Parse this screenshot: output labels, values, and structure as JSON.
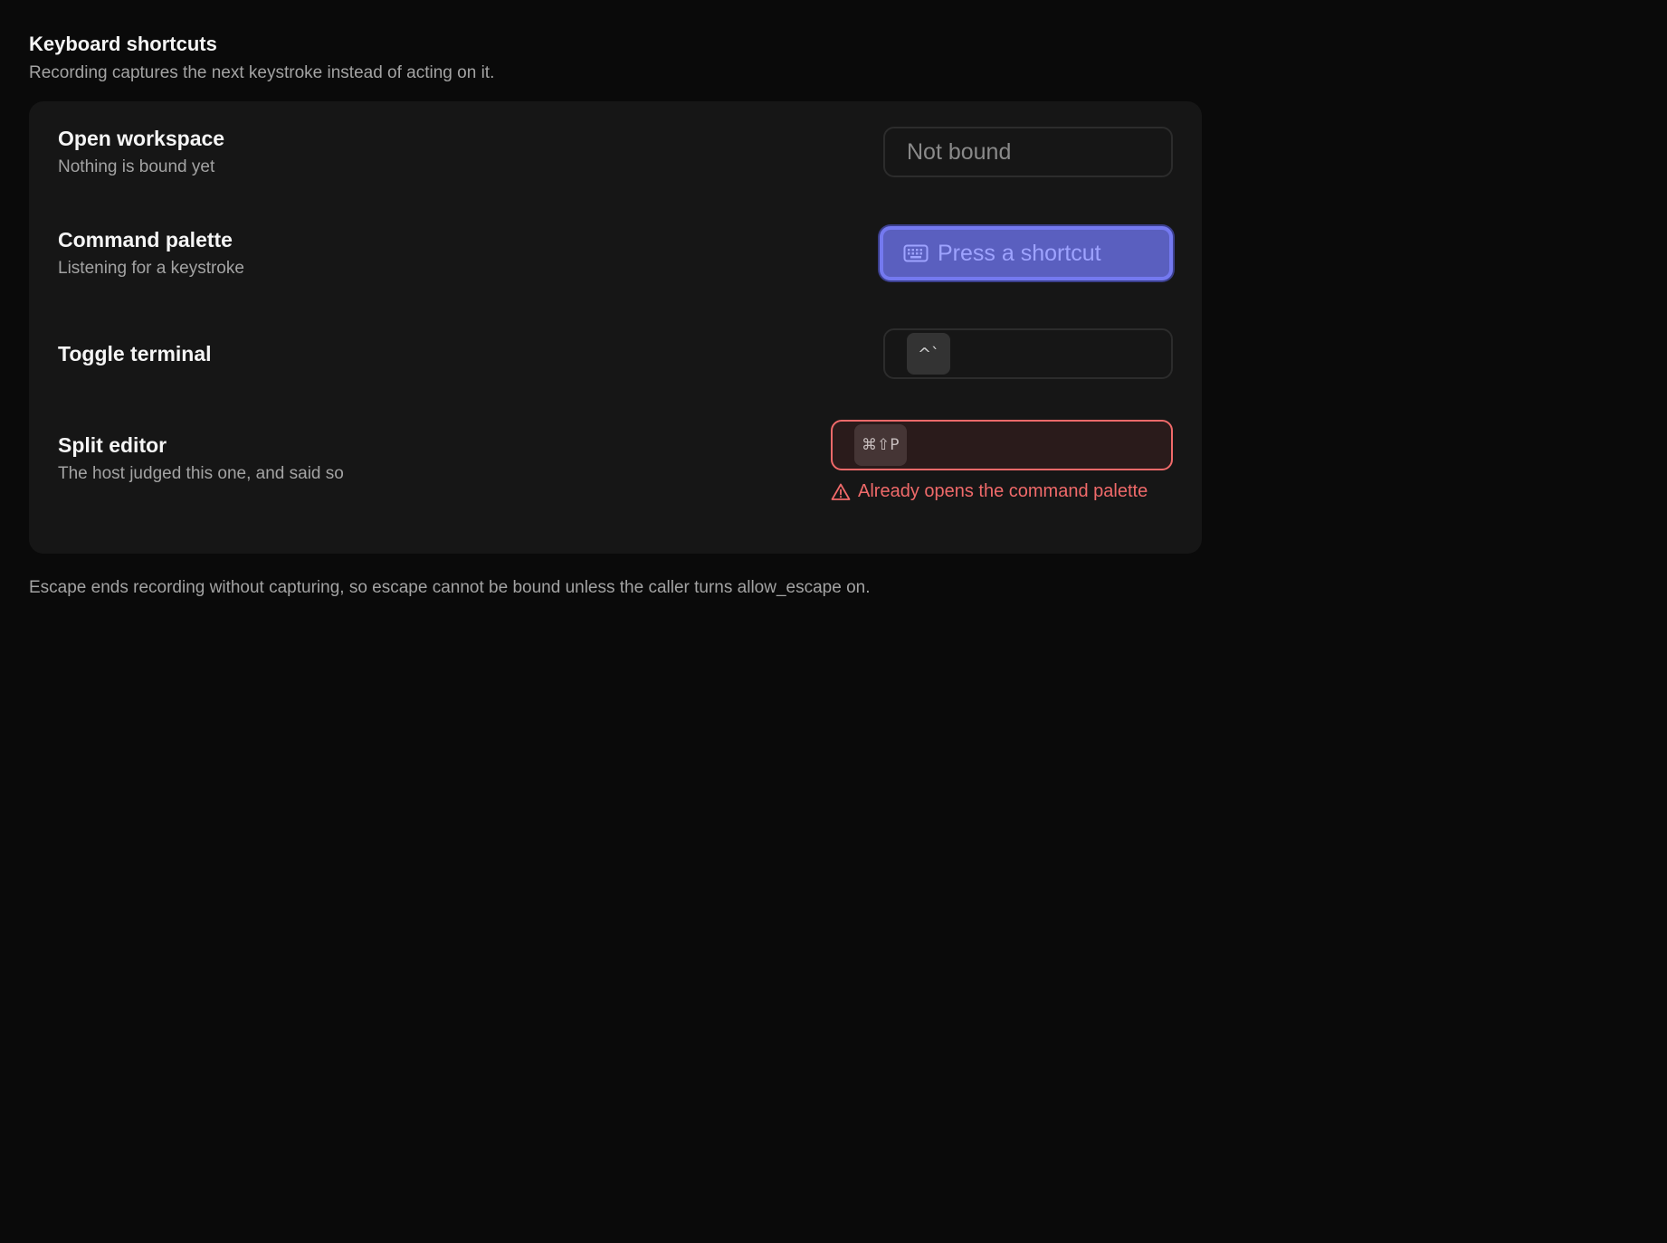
{
  "header": {
    "title": "Keyboard shortcuts",
    "subtitle": "Recording captures the next keystroke instead of acting on it."
  },
  "shortcuts": [
    {
      "name": "Open workspace",
      "description": "Nothing is bound yet",
      "state": "unbound",
      "placeholder": "Not bound"
    },
    {
      "name": "Command palette",
      "description": "Listening for a keystroke",
      "state": "recording",
      "prompt": "Press a shortcut",
      "icon": "keyboard-icon"
    },
    {
      "name": "Toggle terminal",
      "description": "",
      "state": "bound",
      "keys": "^`"
    },
    {
      "name": "Split editor",
      "description": "The host judged this one, and said so",
      "state": "conflict",
      "keys": "⌘⇧P",
      "error": "Already opens the command palette",
      "icon": "warning-icon"
    }
  ],
  "footnote": "Escape ends recording without capturing, so escape cannot be bound unless the caller turns allow_escape on.",
  "colors": {
    "background": "#0a0a0a",
    "card": "#161616",
    "accent": "#7479f0",
    "error": "#f06a6a"
  }
}
